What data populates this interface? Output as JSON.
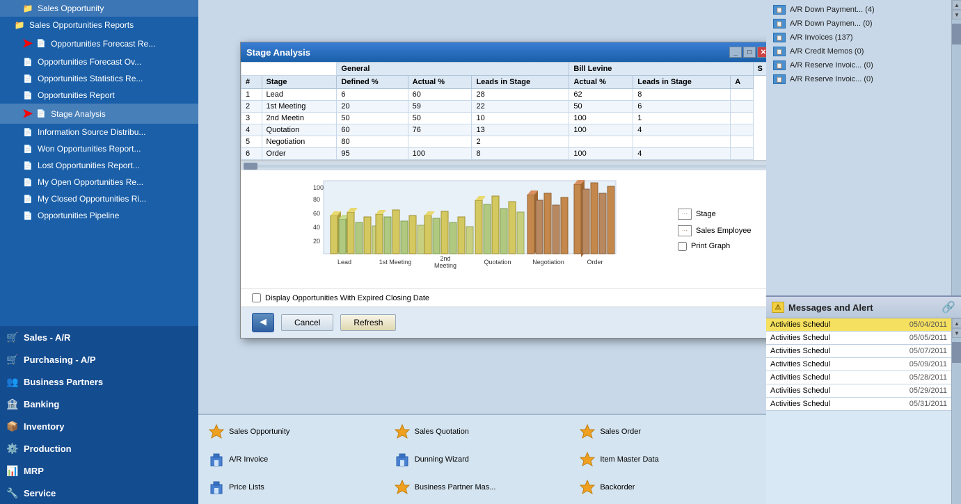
{
  "sidebar": {
    "items": [
      {
        "id": "sales-opportunity",
        "label": "Sales Opportunity",
        "level": "sub2",
        "icon": "folder"
      },
      {
        "id": "sales-opp-reports",
        "label": "Sales Opportunities Reports",
        "level": "sub",
        "icon": "folder"
      },
      {
        "id": "opp-forecast-rep",
        "label": "Opportunities Forecast Rep...",
        "level": "sub2",
        "icon": "doc",
        "arrow": true
      },
      {
        "id": "opp-forecast-ow",
        "label": "Opportunities Forecast Ov...",
        "level": "sub2",
        "icon": "doc"
      },
      {
        "id": "opp-stats-rep",
        "label": "Opportunities Statistics Re...",
        "level": "sub2",
        "icon": "doc"
      },
      {
        "id": "opp-report",
        "label": "Opportunities Report",
        "level": "sub2",
        "icon": "doc"
      },
      {
        "id": "stage-analysis",
        "label": "Stage Analysis",
        "level": "sub2",
        "icon": "doc",
        "arrow": true
      },
      {
        "id": "info-source",
        "label": "Information Source Distribu...",
        "level": "sub2",
        "icon": "doc"
      },
      {
        "id": "won-opp",
        "label": "Won Opportunities Report...",
        "level": "sub2",
        "icon": "doc"
      },
      {
        "id": "lost-opp",
        "label": "Lost Opportunities Report...",
        "level": "sub2",
        "icon": "doc"
      },
      {
        "id": "my-open-opp",
        "label": "My Open Opportunities Re...",
        "level": "sub2",
        "icon": "doc"
      },
      {
        "id": "my-closed-opp",
        "label": "My Closed Opportunities Ri...",
        "level": "sub2",
        "icon": "doc"
      },
      {
        "id": "opp-pipeline",
        "label": "Opportunities Pipeline",
        "level": "sub2",
        "icon": "doc"
      }
    ],
    "sections": [
      {
        "id": "sales-ar",
        "label": "Sales - A/R",
        "icon": "cart"
      },
      {
        "id": "purchasing-ap",
        "label": "Purchasing - A/P",
        "icon": "cart"
      },
      {
        "id": "business-partners",
        "label": "Business Partners",
        "icon": "people"
      },
      {
        "id": "banking",
        "label": "Banking",
        "icon": "bank"
      },
      {
        "id": "inventory",
        "label": "Inventory",
        "icon": "box"
      },
      {
        "id": "production",
        "label": "Production",
        "icon": "gear"
      },
      {
        "id": "mrp",
        "label": "MRP",
        "icon": "chart"
      },
      {
        "id": "service",
        "label": "Service",
        "icon": "wrench"
      }
    ]
  },
  "modal": {
    "title": "Stage Analysis",
    "table": {
      "group_headers": [
        {
          "label": "General",
          "colspan": 4
        },
        {
          "label": "Bill Levine",
          "colspan": 4
        },
        {
          "label": "S",
          "colspan": 1
        }
      ],
      "col_headers": [
        "#",
        "Stage",
        "Defined %",
        "Actual %",
        "Leads in Stage",
        "Actual %",
        "Leads in Stage",
        "A"
      ],
      "rows": [
        {
          "num": 1,
          "stage": "Lead",
          "defined_pct": 6,
          "actual_pct": 60,
          "leads": 28,
          "bl_actual": 62,
          "bl_leads": 8,
          "a": ""
        },
        {
          "num": 2,
          "stage": "1st Meeting",
          "defined_pct": 20,
          "actual_pct": 59,
          "leads": 22,
          "bl_actual": 50,
          "bl_leads": 6,
          "a": ""
        },
        {
          "num": 3,
          "stage": "2nd Meetin",
          "defined_pct": 50,
          "actual_pct": 50,
          "leads": 10,
          "bl_actual": 100,
          "bl_leads": 1,
          "a": ""
        },
        {
          "num": 4,
          "stage": "Quotation",
          "defined_pct": 60,
          "actual_pct": 76,
          "leads": 13,
          "bl_actual": 100,
          "bl_leads": 4,
          "a": ""
        },
        {
          "num": 5,
          "stage": "Negotiation",
          "defined_pct": 80,
          "actual_pct": "",
          "leads": 2,
          "bl_actual": "",
          "bl_leads": "",
          "a": ""
        },
        {
          "num": 6,
          "stage": "Order",
          "defined_pct": 95,
          "actual_pct": 100,
          "leads": 8,
          "bl_actual": 100,
          "bl_leads": 4,
          "a": ""
        }
      ]
    },
    "chart": {
      "labels": [
        "Lead",
        "1st Meeting",
        "2nd Meeting",
        "Quotation",
        "Negotiation",
        "Order"
      ],
      "legend": [
        {
          "label": "Stage",
          "type": "dots"
        },
        {
          "label": "Sales Employee",
          "type": "dots"
        },
        {
          "label": "Print Graph",
          "type": "checkbox"
        }
      ]
    },
    "checkbox_label": "Display Opportunities With Expired Closing Date",
    "buttons": {
      "back_label": "◄",
      "cancel_label": "Cancel",
      "refresh_label": "Refresh"
    }
  },
  "quicklaunch": {
    "items": [
      {
        "label": "Sales Opportunity",
        "icon": "star"
      },
      {
        "label": "Sales Quotation",
        "icon": "star"
      },
      {
        "label": "Sales Order",
        "icon": "star"
      },
      {
        "label": "A/R Invoice",
        "icon": "building"
      },
      {
        "label": "Dunning Wizard",
        "icon": "building"
      },
      {
        "label": "Item Master Data",
        "icon": "star"
      },
      {
        "label": "Price Lists",
        "icon": "building"
      },
      {
        "label": "Business Partner Mas...",
        "icon": "star"
      },
      {
        "label": "Backorder",
        "icon": "star"
      }
    ]
  },
  "right_panel": {
    "items": [
      {
        "label": "A/R Down Payment... (4)",
        "icon": "doc"
      },
      {
        "label": "A/R Down Paymen... (0)",
        "icon": "doc"
      },
      {
        "label": "A/R Invoices (137)",
        "icon": "doc"
      },
      {
        "label": "A/R Credit Memos (0)",
        "icon": "doc"
      },
      {
        "label": "A/R Reserve Invoic... (0)",
        "icon": "doc"
      },
      {
        "label": "A/R Reserve Invoic... (0)",
        "icon": "doc"
      }
    ],
    "messages": {
      "title": "Messages and Alert",
      "items": [
        {
          "label": "Activities Schedul",
          "date": "05/04/2011",
          "highlighted": true
        },
        {
          "label": "Activities Schedul",
          "date": "05/05/2011",
          "highlighted": false
        },
        {
          "label": "Activities Schedul",
          "date": "05/07/2011",
          "highlighted": false
        },
        {
          "label": "Activities Schedul",
          "date": "05/09/2011",
          "highlighted": false
        },
        {
          "label": "Activities Schedul",
          "date": "05/28/2011",
          "highlighted": false
        },
        {
          "label": "Activities Schedul",
          "date": "05/29/2011",
          "highlighted": false
        },
        {
          "label": "Activities Schedul",
          "date": "05/31/2011",
          "highlighted": false
        }
      ]
    }
  }
}
